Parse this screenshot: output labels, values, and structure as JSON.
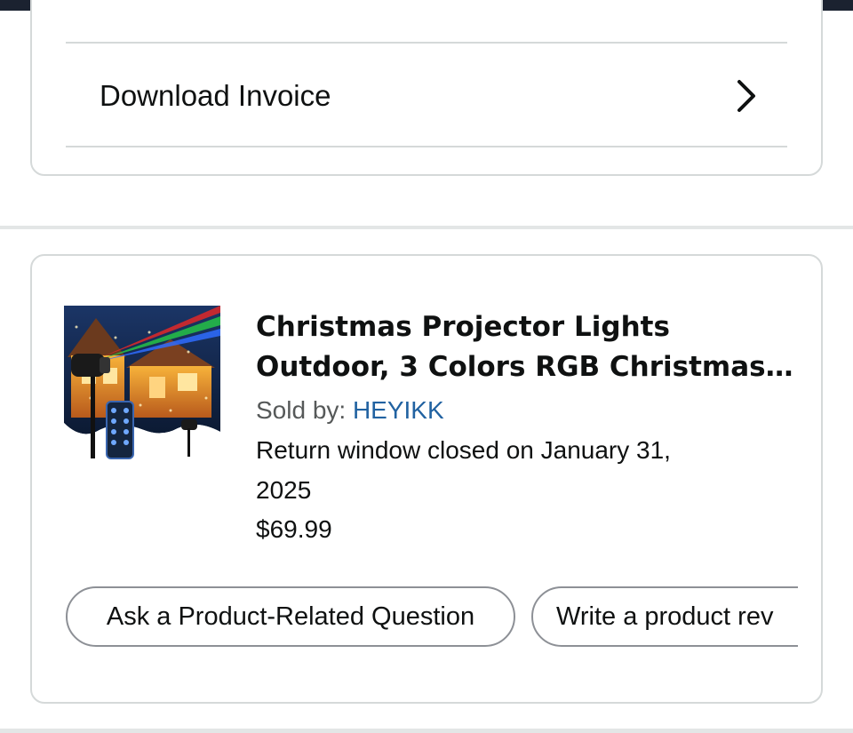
{
  "invoice": {
    "label": "Download Invoice"
  },
  "product": {
    "title_line1": "Christmas Projector Lights",
    "title_line2": "Outdoor, 3 Colors RGB Christmas…",
    "sold_by_label": "Sold by: ",
    "seller": "HEYIKK",
    "return_line1": "Return window closed on January 31,",
    "return_line2": "2025",
    "price": "$69.99",
    "image_icon": "projector-lights-product-image"
  },
  "actions": {
    "ask_question": "Ask a Product-Related Question",
    "write_review": "Write a product rev"
  },
  "colors": {
    "link": "#2162a1",
    "border": "#d5d9d9",
    "text": "#0f1111",
    "muted": "#565959",
    "top_bar": "#1b2230"
  }
}
